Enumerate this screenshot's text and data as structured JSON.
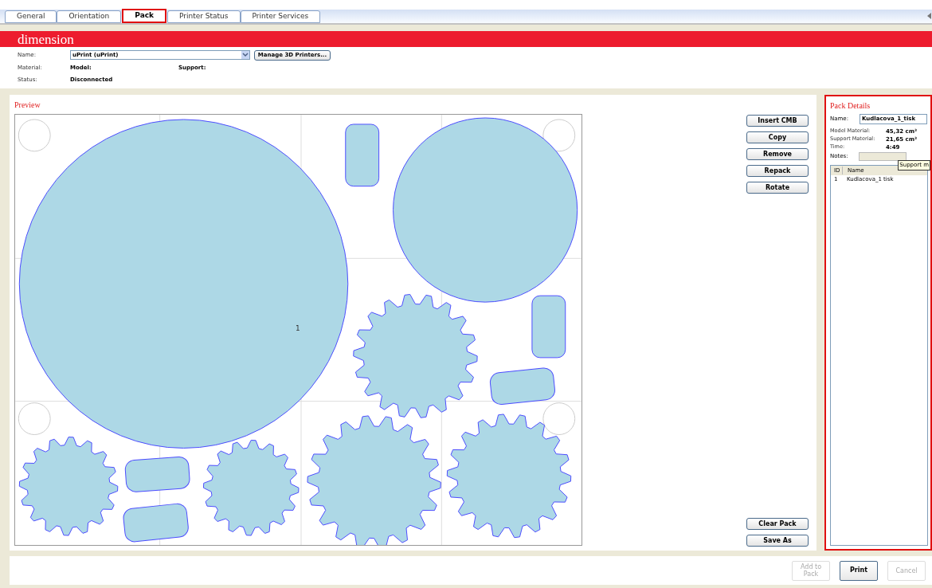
{
  "tabs": [
    {
      "label": "General",
      "selected": false
    },
    {
      "label": "Orientation",
      "selected": false
    },
    {
      "label": "Pack",
      "selected": true
    },
    {
      "label": "Printer Status",
      "selected": false
    },
    {
      "label": "Printer Services",
      "selected": false
    }
  ],
  "brand": {
    "logo": "dimension"
  },
  "printer": {
    "name_label": "Name:",
    "name_value": "uPrint  (uPrint)",
    "manage_button": "Manage 3D Printers...",
    "material_label": "Material:",
    "model_label": "Model:",
    "support_label": "Support:",
    "status_label": "Status:",
    "status_value": "Disconnected"
  },
  "preview": {
    "title": "Preview",
    "part_label": "1"
  },
  "actions": [
    "Insert CMB",
    "Copy",
    "Remove",
    "Repack",
    "Rotate"
  ],
  "bottom_actions": [
    "Clear Pack",
    "Save As"
  ],
  "pack_details": {
    "title": "Pack Details",
    "name_label": "Name:",
    "name_value": "Kudlacova_1_tisk",
    "stats": [
      {
        "label": "Model Material:",
        "value": "45,32 cm³"
      },
      {
        "label": "Support Material:",
        "value": "21,65 cm³"
      },
      {
        "label": "Time:",
        "value": "4:49"
      }
    ],
    "notes_label": "Notes:",
    "tooltip": "Support m",
    "columns": [
      "ID",
      "Name"
    ],
    "rows": [
      {
        "id": "1",
        "name": "Kudlacova_1 tisk"
      }
    ]
  },
  "footer": [
    {
      "label": "Add to Pack",
      "disabled": true
    },
    {
      "label": "Print",
      "disabled": false
    },
    {
      "label": "Cancel",
      "disabled": true
    }
  ]
}
